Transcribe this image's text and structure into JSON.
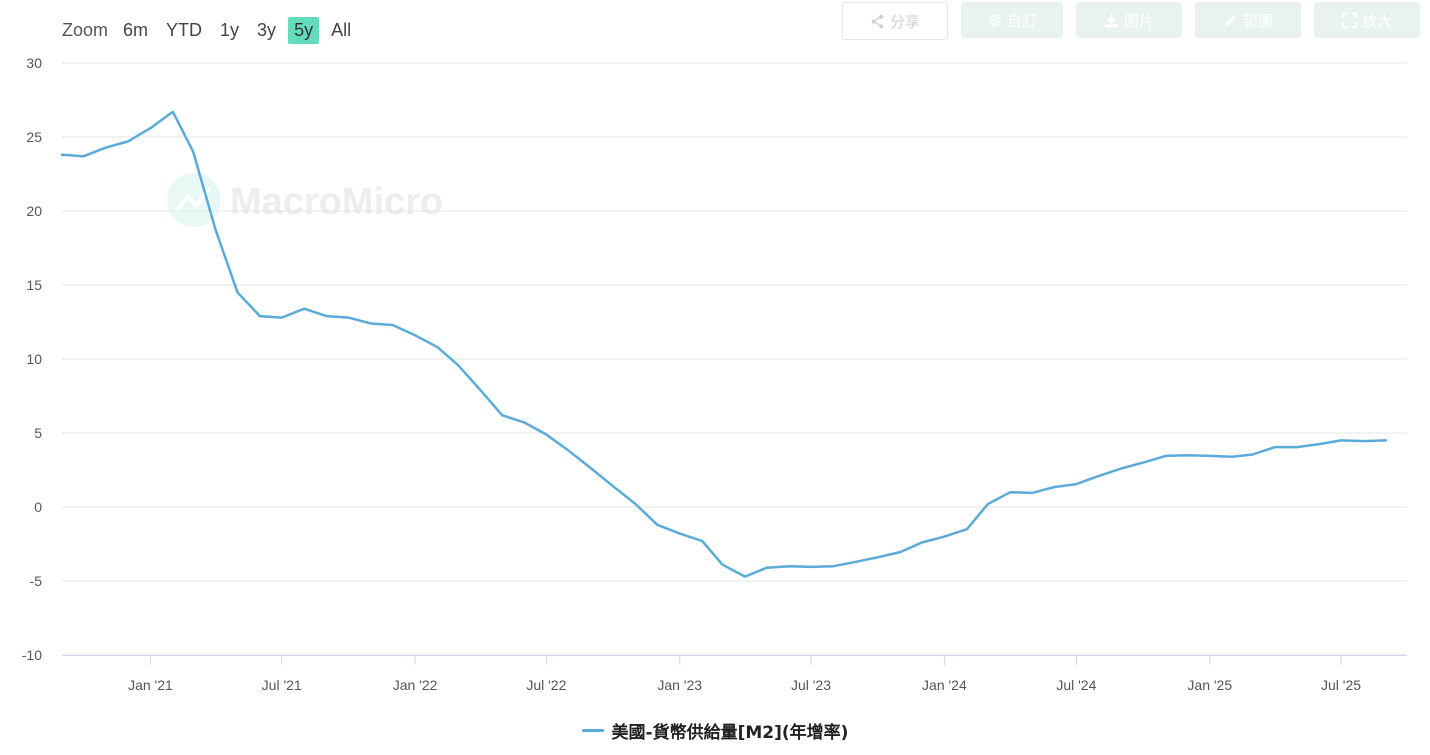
{
  "zoom": {
    "label": "Zoom",
    "options": [
      "6m",
      "YTD",
      "1y",
      "3y",
      "5y",
      "All"
    ],
    "active": "5y"
  },
  "toolbar": {
    "share": "分享",
    "subscribe": "自訂",
    "download": "圖片",
    "edit": "製圖",
    "fullscreen": "放大"
  },
  "watermark": "MacroMicro",
  "colors": {
    "line": "#5aabd9",
    "grid": "#e6e6e6",
    "active_zoom": "#62dcbd"
  },
  "chart_data": {
    "type": "line",
    "title": "",
    "xlabel": "",
    "ylabel": "",
    "ylim": [
      -10,
      30
    ],
    "yticks": [
      -10,
      -5,
      0,
      5,
      10,
      15,
      20,
      25,
      30
    ],
    "xlim": [
      "2020-09-01",
      "2025-09-30"
    ],
    "xticks": [
      {
        "date": "2021-01-01",
        "label": "Jan '21"
      },
      {
        "date": "2021-07-01",
        "label": "Jul '21"
      },
      {
        "date": "2022-01-01",
        "label": "Jan '22"
      },
      {
        "date": "2022-07-01",
        "label": "Jul '22"
      },
      {
        "date": "2023-01-01",
        "label": "Jan '23"
      },
      {
        "date": "2023-07-01",
        "label": "Jul '23"
      },
      {
        "date": "2024-01-01",
        "label": "Jan '24"
      },
      {
        "date": "2024-07-01",
        "label": "Jul '24"
      },
      {
        "date": "2025-01-01",
        "label": "Jan '25"
      },
      {
        "date": "2025-07-01",
        "label": "Jul '25"
      }
    ],
    "grid": true,
    "legend_position": "bottom-center",
    "series": [
      {
        "name": "美國-貨幣供給量[M2](年增率)",
        "color": "#5aabd9",
        "dates": [
          "2020-09-01",
          "2020-10-01",
          "2020-11-01",
          "2020-12-01",
          "2021-01-01",
          "2021-02-01",
          "2021-03-01",
          "2021-04-01",
          "2021-05-01",
          "2021-06-01",
          "2021-07-01",
          "2021-08-01",
          "2021-09-01",
          "2021-10-01",
          "2021-11-01",
          "2021-12-01",
          "2022-01-01",
          "2022-02-01",
          "2022-03-01",
          "2022-04-01",
          "2022-05-01",
          "2022-06-01",
          "2022-07-01",
          "2022-08-01",
          "2022-09-01",
          "2022-10-01",
          "2022-11-01",
          "2022-12-01",
          "2023-01-01",
          "2023-02-01",
          "2023-03-01",
          "2023-04-01",
          "2023-05-01",
          "2023-06-01",
          "2023-07-01",
          "2023-08-01",
          "2023-09-01",
          "2023-10-01",
          "2023-11-01",
          "2023-12-01",
          "2024-01-01",
          "2024-02-01",
          "2024-03-01",
          "2024-04-01",
          "2024-05-01",
          "2024-06-01",
          "2024-07-01",
          "2024-08-01",
          "2024-09-01",
          "2024-10-01",
          "2024-11-01",
          "2024-12-01",
          "2025-01-01",
          "2025-02-01",
          "2025-03-01",
          "2025-04-01",
          "2025-05-01",
          "2025-06-01",
          "2025-07-01",
          "2025-08-01",
          "2025-09-01"
        ],
        "values": [
          23.8,
          23.7,
          24.3,
          24.7,
          25.6,
          26.7,
          24.0,
          18.7,
          14.5,
          12.9,
          12.8,
          13.4,
          12.9,
          12.8,
          12.4,
          12.3,
          11.6,
          10.8,
          9.6,
          7.9,
          6.2,
          5.7,
          4.9,
          3.8,
          2.6,
          1.4,
          0.2,
          -1.2,
          -1.8,
          -2.3,
          -3.9,
          -4.7,
          -4.1,
          -4.0,
          -4.05,
          -4.0,
          -3.7,
          -3.4,
          -3.05,
          -2.4,
          -2.0,
          -1.5,
          0.2,
          1.0,
          0.95,
          1.35,
          1.55,
          2.1,
          2.6,
          3.0,
          3.45,
          3.5,
          3.45,
          3.4,
          3.55,
          4.05,
          4.05,
          4.25,
          4.5,
          4.45,
          4.5
        ]
      }
    ]
  }
}
